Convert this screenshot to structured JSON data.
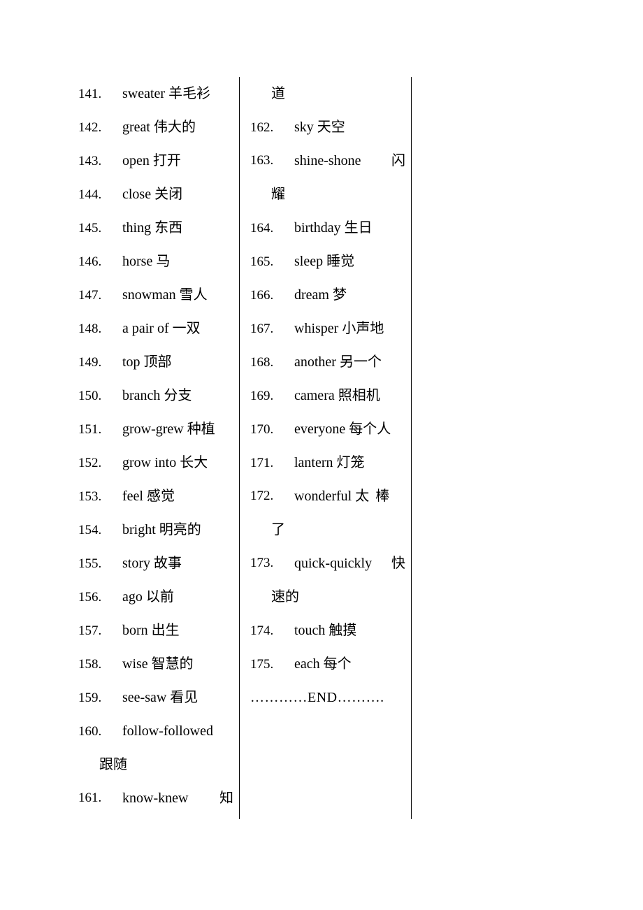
{
  "document": {
    "type": "vocabulary-list",
    "columns": [
      {
        "name": "left-column",
        "lines": [
          {
            "kind": "entry",
            "num": "141.",
            "term": "sweater 羊毛衫"
          },
          {
            "kind": "entry",
            "num": "142.",
            "term": "great 伟大的"
          },
          {
            "kind": "entry",
            "num": "143.",
            "term": "open 打开"
          },
          {
            "kind": "entry",
            "num": "144.",
            "term": "close 关闭"
          },
          {
            "kind": "entry",
            "num": "145.",
            "term": "thing 东西"
          },
          {
            "kind": "entry",
            "num": "146.",
            "term": "horse 马"
          },
          {
            "kind": "entry",
            "num": "147.",
            "term": "snowman 雪人"
          },
          {
            "kind": "entry",
            "num": "148.",
            "term": "a pair of 一双"
          },
          {
            "kind": "entry",
            "num": "149.",
            "term": "top 顶部"
          },
          {
            "kind": "entry",
            "num": "150.",
            "term": "branch 分支"
          },
          {
            "kind": "entry",
            "num": "151.",
            "term": "grow-grew 种植"
          },
          {
            "kind": "entry",
            "num": "152.",
            "term": "grow into 长大"
          },
          {
            "kind": "entry",
            "num": "153.",
            "term": "feel 感觉"
          },
          {
            "kind": "entry",
            "num": "154.",
            "term": "bright 明亮的"
          },
          {
            "kind": "entry",
            "num": "155.",
            "term": "story 故事"
          },
          {
            "kind": "entry",
            "num": "156.",
            "term": "ago 以前"
          },
          {
            "kind": "entry",
            "num": "157.",
            "term": "born 出生"
          },
          {
            "kind": "entry",
            "num": "158.",
            "term": "wise 智慧的"
          },
          {
            "kind": "entry",
            "num": "159.",
            "term": "see-saw 看见"
          },
          {
            "kind": "entry",
            "num": "160.",
            "term": "follow-followed"
          },
          {
            "kind": "continuation",
            "text": "跟随"
          },
          {
            "kind": "spread",
            "num": "161.",
            "term": "know-knew",
            "tail": "知"
          }
        ]
      },
      {
        "name": "right-column",
        "lines": [
          {
            "kind": "continuation",
            "text": "道"
          },
          {
            "kind": "entry",
            "num": "162.",
            "term": "sky 天空"
          },
          {
            "kind": "spread",
            "num": "163.",
            "term": "shine-shone",
            "tail": "闪"
          },
          {
            "kind": "continuation",
            "text": "耀"
          },
          {
            "kind": "entry",
            "num": "164.",
            "term": "birthday 生日"
          },
          {
            "kind": "entry",
            "num": "165.",
            "term": "sleep 睡觉"
          },
          {
            "kind": "entry",
            "num": "166.",
            "term": "dream 梦"
          },
          {
            "kind": "entry",
            "num": "167.",
            "term": "whisper 小声地"
          },
          {
            "kind": "entry",
            "num": "168.",
            "term": "another 另一个"
          },
          {
            "kind": "entry",
            "num": "169.",
            "term": "camera 照相机"
          },
          {
            "kind": "entry",
            "num": "170.",
            "term": "everyone 每个人"
          },
          {
            "kind": "entry",
            "num": "171.",
            "term": "lantern 灯笼"
          },
          {
            "kind": "spread",
            "num": "172.",
            "term": "wonderful 太 棒",
            "tail": ""
          },
          {
            "kind": "continuation",
            "text": "了"
          },
          {
            "kind": "spread",
            "num": "173.",
            "term": "quick-quickly",
            "tail": "快"
          },
          {
            "kind": "continuation",
            "text": "速的"
          },
          {
            "kind": "entry",
            "num": "174.",
            "term": "touch 触摸"
          },
          {
            "kind": "entry",
            "num": "175.",
            "term": "each 每个"
          },
          {
            "kind": "end",
            "text": "…………END………."
          }
        ]
      }
    ]
  }
}
